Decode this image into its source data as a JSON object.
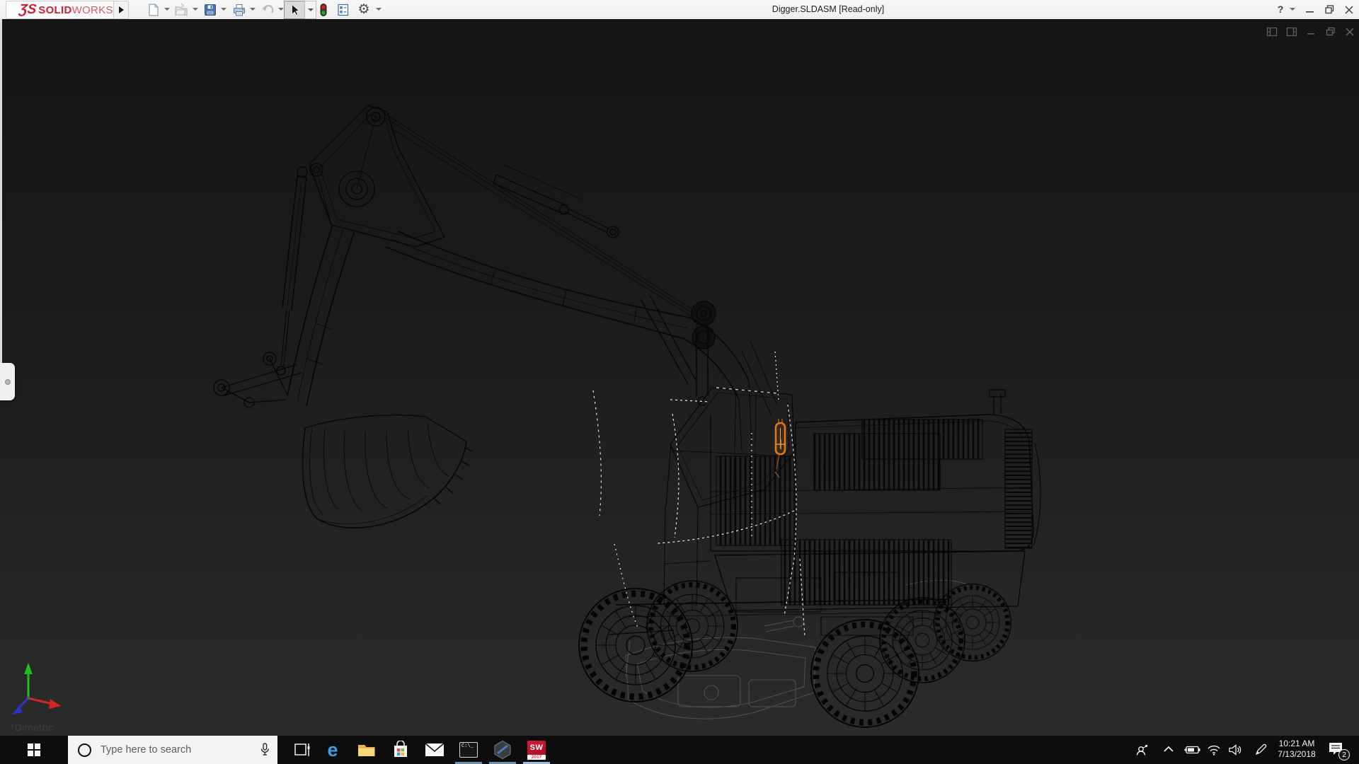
{
  "window": {
    "title": "Digger.SLDASM [Read-only]",
    "brand": {
      "glyph": "ƷS",
      "solid": "SOLID",
      "works": "WORKS"
    },
    "help_glyph": "?",
    "controls": [
      "help",
      "minimize",
      "restore",
      "close"
    ]
  },
  "toolbar": {
    "icons": [
      "new-document",
      "open-document",
      "save",
      "print",
      "undo",
      "select-tool",
      "rebuild-traffic-light",
      "file-properties",
      "options-gear"
    ],
    "select_tool_state": "pressed"
  },
  "viewport": {
    "view_orientation_label": "*Dimetric",
    "selected_part_color": "#e0791c",
    "highlight_edge_color": "#e4e4e4",
    "wireframe_color": "#060606",
    "ghost_part_color": "#575757",
    "triad": {
      "x_axis_color": "#d22626",
      "y_axis_color": "#1fbf1f",
      "z_axis_color": "#2a35c8"
    },
    "controls": [
      "pane-left",
      "pane-right",
      "minimize-child",
      "restore-child",
      "close-child"
    ],
    "flyout_tab": "featuremanager-collapsed-tab"
  },
  "taskbar": {
    "search_placeholder": "Type here to search",
    "apps": [
      {
        "name": "task-view"
      },
      {
        "name": "microsoft-edge",
        "label": "e"
      },
      {
        "name": "file-explorer"
      },
      {
        "name": "microsoft-store"
      },
      {
        "name": "mail"
      },
      {
        "name": "command-prompt",
        "label": "C:\\_",
        "running": true
      },
      {
        "name": "3d-viewer",
        "running": true
      },
      {
        "name": "solidworks-2017",
        "label": "SW",
        "sublabel": "2017",
        "running": true,
        "active": true
      }
    ],
    "running_indicator_color": "#6f93ad",
    "tray": {
      "icons": [
        "people",
        "hidden-icons-chevron",
        "battery",
        "wifi",
        "volume",
        "windows-ink"
      ],
      "time": "10:21 AM",
      "date": "7/13/2018",
      "notification_count": "2"
    }
  }
}
